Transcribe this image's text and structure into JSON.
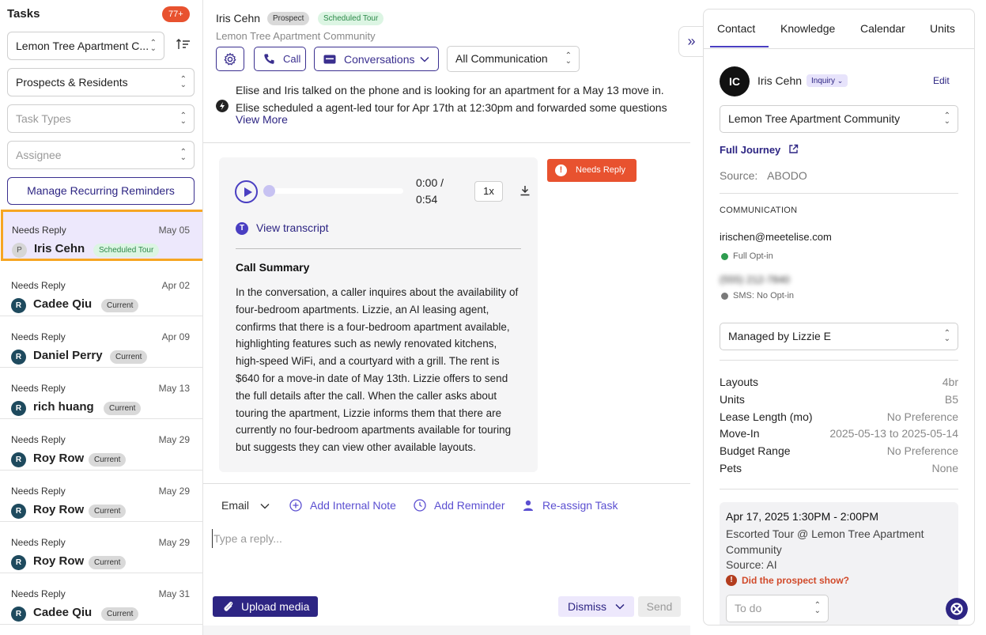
{
  "sidebar": {
    "title": "Tasks",
    "count": "77+",
    "community_select": "Lemon Tree Apartment C...",
    "people_select": "Prospects & Residents",
    "task_types_placeholder": "Task Types",
    "assignee_placeholder": "Assignee",
    "manage_button": "Manage Recurring Reminders",
    "tasks": [
      {
        "status": "Needs Reply",
        "date": "May 05",
        "initial": "P",
        "name": "Iris Cehn",
        "badge": "Scheduled Tour"
      },
      {
        "status": "Needs Reply",
        "date": "Apr 02",
        "initial": "R",
        "name": "Cadee Qiu",
        "badge": "Current"
      },
      {
        "status": "Needs Reply",
        "date": "Apr 09",
        "initial": "R",
        "name": "Daniel Perry",
        "badge": "Current"
      },
      {
        "status": "Needs Reply",
        "date": "May 13",
        "initial": "R",
        "name": "rich huang",
        "badge": "Current"
      },
      {
        "status": "Needs Reply",
        "date": "May 29",
        "initial": "R",
        "name": "Roy Row",
        "badge": "Current"
      },
      {
        "status": "Needs Reply",
        "date": "May 29",
        "initial": "R",
        "name": "Roy Row",
        "badge": "Current"
      },
      {
        "status": "Needs Reply",
        "date": "May 29",
        "initial": "R",
        "name": "Roy Row",
        "badge": "Current"
      },
      {
        "status": "Needs Reply",
        "date": "May 31",
        "initial": "R",
        "name": "Cadee Qiu",
        "badge": "Current"
      }
    ]
  },
  "header": {
    "name": "Iris Cehn",
    "prospect_badge": "Prospect",
    "tour_badge": "Scheduled Tour",
    "community": "Lemon Tree Apartment Community",
    "call_label": "Call",
    "conversations_label": "Conversations",
    "comm_filter": "All Communication",
    "summary": "Elise and Iris talked on the phone and is looking for an apartment for a May 13 move in. Elise scheduled a agent-led tour for Apr 17th at 12:30pm and forwarded some questions to a",
    "view_more": "View More"
  },
  "call": {
    "time_current": "0:00 /",
    "time_total": "0:54",
    "speed": "1x",
    "view_transcript": "View transcript",
    "summary_title": "Call Summary",
    "summary_body": "In the conversation, a caller inquires about the availability of four-bedroom apartments. Lizzie, an AI leasing agent, confirms that there is a four-bedroom apartment available, highlighting features such as newly renovated kitchens, high-speed WiFi, and a courtyard with a grill. The rent is $640 for a move-in date of May 13th. Lizzie offers to send the full details after the call. When the caller asks about touring the apartment, Lizzie informs them that there are currently no four-bedroom apartments available for touring but suggests they can view other available layouts.",
    "needs_reply": "Needs Reply"
  },
  "reply": {
    "channel": "Email",
    "add_note": "Add Internal Note",
    "add_reminder": "Add Reminder",
    "reassign": "Re-assign Task",
    "placeholder": "Type a reply...",
    "upload": "Upload media",
    "dismiss": "Dismiss",
    "send": "Send"
  },
  "right": {
    "tabs": [
      "Contact",
      "Knowledge",
      "Calendar",
      "Units"
    ],
    "initials": "IC",
    "name": "Iris Cehn",
    "status": "Inquiry",
    "edit": "Edit",
    "community": "Lemon Tree Apartment Community",
    "full_journey": "Full Journey",
    "source_label": "Source:",
    "source_value": "ABODO",
    "comm_heading": "COMMUNICATION",
    "email": "irischen@meetelise.com",
    "email_optin": "Full Opt-in",
    "phone": "(555) 212-7840",
    "sms_optin": "SMS: No Opt-in",
    "managed_by": "Managed by Lizzie E",
    "props": [
      {
        "label": "Layouts",
        "value": "4br"
      },
      {
        "label": "Units",
        "value": "B5"
      },
      {
        "label": "Lease Length (mo)",
        "value": "No Preference"
      },
      {
        "label": "Move-In",
        "value": "2025-05-13 to 2025-05-14"
      },
      {
        "label": "Budget Range",
        "value": "No Preference"
      },
      {
        "label": "Pets",
        "value": "None"
      }
    ],
    "tour": {
      "time": "Apr 17, 2025 1:30PM - 2:00PM",
      "desc": "Escorted Tour @ Lemon Tree Apartment Community",
      "source": "Source: AI",
      "question": "Did the prospect show?",
      "todo": "To do"
    }
  },
  "colors": {
    "brand": "#2d2583",
    "accent": "#4a3fc2",
    "alert": "#e8522f",
    "highlight": "#f6a623"
  }
}
